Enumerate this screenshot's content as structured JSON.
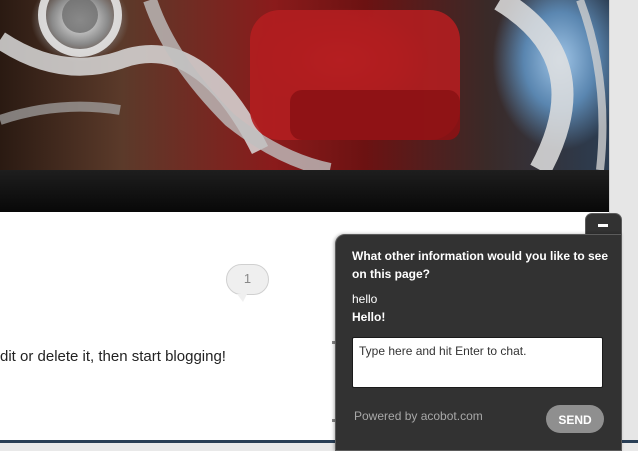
{
  "comments": {
    "count": "1"
  },
  "post": {
    "text": "dit or delete it, then start blogging!"
  },
  "chat": {
    "question": "What other information would you like to see on this page?",
    "messages": [
      {
        "from": "user",
        "text": "hello"
      },
      {
        "from": "bot",
        "text": "Hello!"
      }
    ],
    "input_placeholder": "Type here and hit Enter to chat.",
    "powered_by": "Powered by acobot.com",
    "send_label": "SEND",
    "minimize_icon": "minimize-icon"
  },
  "colors": {
    "chat_bg": "#323232",
    "send_button": "#8f8f8f",
    "navbar": "#0d0d0d"
  }
}
